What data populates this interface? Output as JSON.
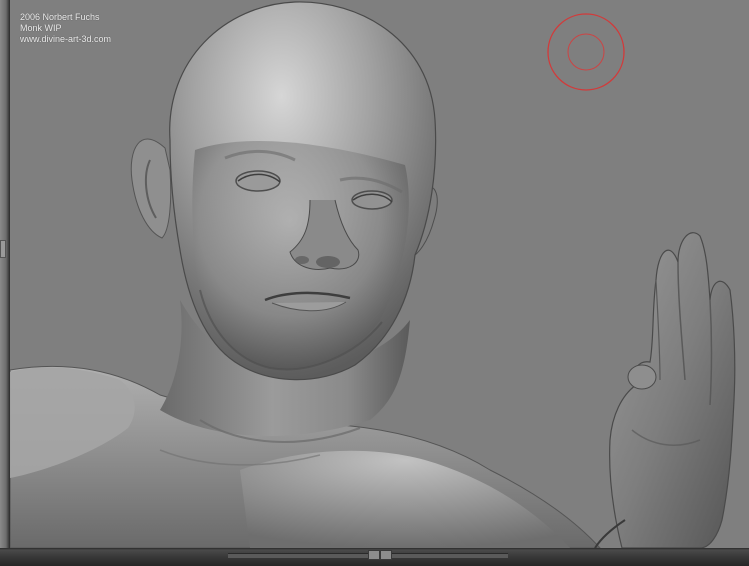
{
  "canvas": {
    "credits": {
      "line1": "2006 Norbert Fuchs",
      "line2": "Monk WIP",
      "line3": "www.divine-art-3d.com"
    }
  },
  "icons": {
    "brush_cursor": "circle-brush-icon"
  },
  "colors": {
    "background": "#7f7f7f",
    "model": "#8e8e8e",
    "brush_cursor": "#d23a3a"
  }
}
